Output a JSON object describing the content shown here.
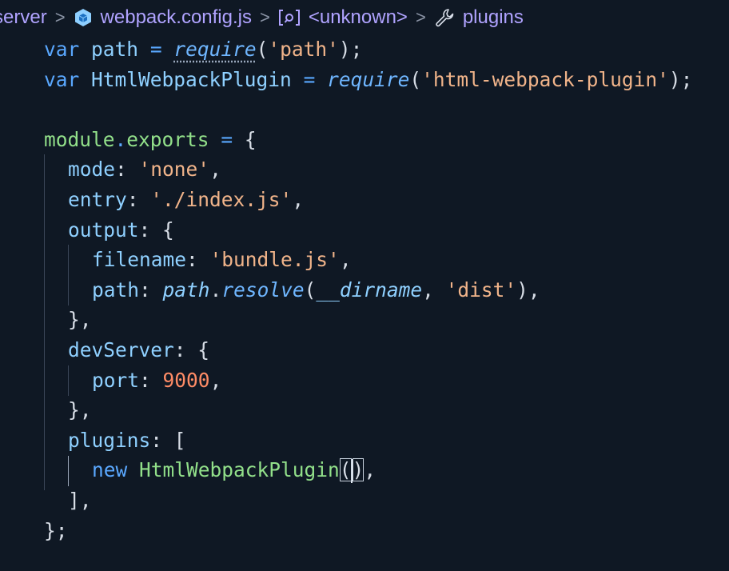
{
  "breadcrumb": {
    "items": [
      {
        "label": "server",
        "icon": "folder"
      },
      {
        "label": "webpack.config.js",
        "icon": "webpack-cube-icon"
      },
      {
        "label": "<unknown>",
        "icon": "bracket-symbol-icon"
      },
      {
        "label": "plugins",
        "icon": "wrench-icon"
      }
    ],
    "separator": ">"
  },
  "code": {
    "lines": [
      "var path = require('path');",
      "var HtmlWebpackPlugin = require('html-webpack-plugin');",
      "",
      "module.exports = {",
      "  mode: 'none',",
      "  entry: './index.js',",
      "  output: {",
      "    filename: 'bundle.js',",
      "    path: path.resolve(__dirname, 'dist'),",
      "  },",
      "  devServer: {",
      "    port: 9000,",
      "  },",
      "  plugins: [",
      "    new HtmlWebpackPlugin(),",
      "  ],",
      "};"
    ],
    "tokens": {
      "l1": {
        "kw": "var",
        "ident": "path",
        "eq": "=",
        "req": "require",
        "open": "(",
        "str": "'path'",
        "close": ");"
      },
      "l2": {
        "kw": "var",
        "ident": "HtmlWebpackPlugin",
        "eq": "=",
        "req": "require",
        "open": "(",
        "str": "'html-webpack-plugin'",
        "close": ");"
      },
      "l4": {
        "module": "module",
        "dot": ".",
        "exports": "exports",
        "eq": "=",
        "brace": "{"
      },
      "l5": {
        "key": "mode",
        "colon": ":",
        "str": "'none'",
        "comma": ","
      },
      "l6": {
        "key": "entry",
        "colon": ":",
        "str": "'./index.js'",
        "comma": ","
      },
      "l7": {
        "key": "output",
        "colon": ":",
        "brace": "{"
      },
      "l8": {
        "key": "filename",
        "colon": ":",
        "str": "'bundle.js'",
        "comma": ","
      },
      "l9": {
        "key": "path",
        "colon": ":",
        "obj": "path",
        "dot": ".",
        "fn": "resolve",
        "open": "(",
        "arg": "__dirname",
        "comma1": ",",
        "str": "'dist'",
        "close": "),"
      },
      "l10": {
        "text": "},"
      },
      "l11": {
        "key": "devServer",
        "colon": ":",
        "brace": "{"
      },
      "l12": {
        "key": "port",
        "colon": ":",
        "num": "9000",
        "comma": ","
      },
      "l13": {
        "text": "},"
      },
      "l14": {
        "key": "plugins",
        "colon": ":",
        "bracket": "["
      },
      "l15": {
        "kw": "new",
        "cls": "HtmlWebpackPlugin",
        "open": "(",
        "close": ")",
        "comma": ","
      },
      "l16": {
        "text": "],"
      },
      "l17": {
        "text": "};"
      }
    }
  },
  "colors": {
    "background": "#0f1824",
    "keyword": "#5aa8ff",
    "identifier": "#8fd0ff",
    "string": "#f1b48a",
    "number": "#ff8c66",
    "class": "#92e08a",
    "breadcrumb": "#b0a3ff"
  }
}
